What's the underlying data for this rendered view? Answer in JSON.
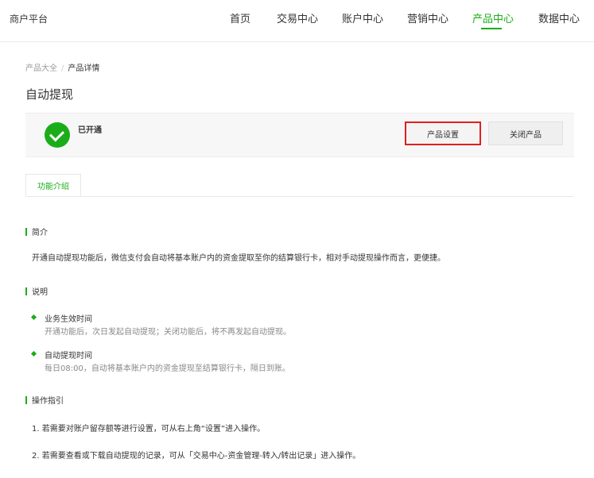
{
  "header": {
    "brand": "商户平台",
    "nav": [
      {
        "label": "首页",
        "active": false
      },
      {
        "label": "交易中心",
        "active": false
      },
      {
        "label": "账户中心",
        "active": false
      },
      {
        "label": "营销中心",
        "active": false
      },
      {
        "label": "产品中心",
        "active": true
      },
      {
        "label": "数据中心",
        "active": false
      }
    ]
  },
  "breadcrumb": {
    "parent": "产品大全",
    "separator": "/",
    "current": "产品详情"
  },
  "page_title": "自动提现",
  "status": {
    "text": "已开通",
    "settings_button": "产品设置",
    "close_button": "关闭产品"
  },
  "tabs": [
    {
      "label": "功能介绍",
      "active": true
    }
  ],
  "intro": {
    "heading": "简介",
    "text": "开通自动提现功能后，微信支付会自动将基本账户内的资金提取至你的结算银行卡，相对手动提现操作而言，更便捷。"
  },
  "notes": {
    "heading": "说明",
    "items": [
      {
        "title": "业务生效时间",
        "desc": "开通功能后，次日发起自动提现；关闭功能后，将不再发起自动提现。"
      },
      {
        "title": "自动提现时间",
        "desc": "每日08:00，自动将基本账户内的资金提现至结算银行卡，隔日到账。"
      }
    ]
  },
  "guide": {
    "heading": "操作指引",
    "steps": [
      "1. 若需要对账户留存额等进行设置，可从右上角“设置”进入操作。",
      "2. 若需要查看或下载自动提现的记录，可从「交易中心-资金管理-转入/转出记录」进入操作。"
    ]
  },
  "colors": {
    "accent": "#1aad19",
    "highlight": "#e0201f"
  }
}
